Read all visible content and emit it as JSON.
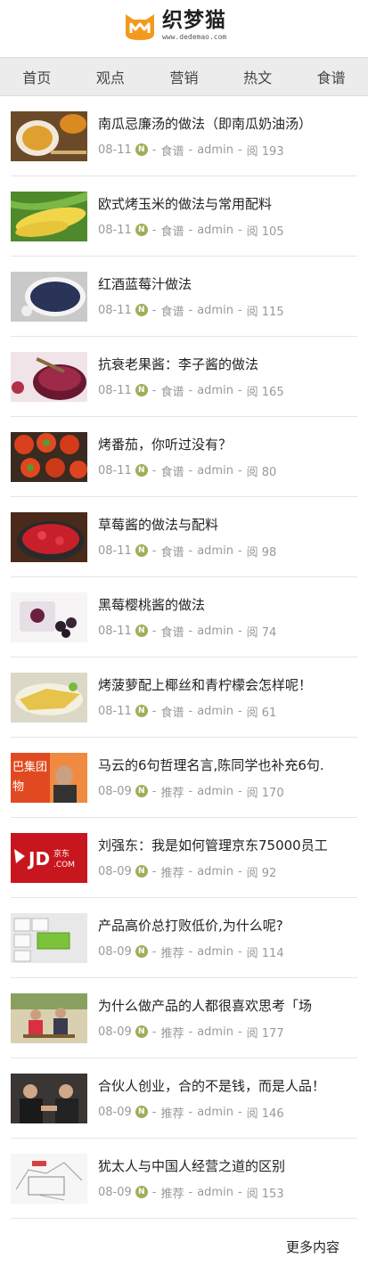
{
  "header": {
    "logo_cn": "织梦猫",
    "logo_url": "www.dedemao.com"
  },
  "nav": [
    "首页",
    "观点",
    "营销",
    "热文",
    "食谱"
  ],
  "articles": [
    {
      "title": "南瓜忌廉汤的做法（即南瓜奶油汤）",
      "date": "08-11",
      "category": "食谱",
      "author": "admin",
      "views": "阅 193",
      "thumb": "pumpkin-soup"
    },
    {
      "title": "欧式烤玉米的做法与常用配料",
      "date": "08-11",
      "category": "食谱",
      "author": "admin",
      "views": "阅 105",
      "thumb": "corn"
    },
    {
      "title": "红酒蓝莓汁做法",
      "date": "08-11",
      "category": "食谱",
      "author": "admin",
      "views": "阅 115",
      "thumb": "blueberry"
    },
    {
      "title": "抗衰老果酱：李子酱的做法",
      "date": "08-11",
      "category": "食谱",
      "author": "admin",
      "views": "阅 165",
      "thumb": "plum-jam"
    },
    {
      "title": "烤番茄，你听过没有？",
      "date": "08-11",
      "category": "食谱",
      "author": "admin",
      "views": "阅 80",
      "thumb": "tomato"
    },
    {
      "title": "草莓酱的做法与配料",
      "date": "08-11",
      "category": "食谱",
      "author": "admin",
      "views": "阅 98",
      "thumb": "strawberry"
    },
    {
      "title": "黑莓樱桃酱的做法",
      "date": "08-11",
      "category": "食谱",
      "author": "admin",
      "views": "阅 74",
      "thumb": "blackberry"
    },
    {
      "title": "烤菠萝配上椰丝和青柠檬会怎样呢！",
      "date": "08-11",
      "category": "食谱",
      "author": "admin",
      "views": "阅 61",
      "thumb": "pineapple"
    },
    {
      "title": "马云的6句哲理名言,陈同学也补充6句.",
      "date": "08-09",
      "category": "推荐",
      "author": "admin",
      "views": "阅 170",
      "thumb": "alibaba"
    },
    {
      "title": "刘强东：我是如何管理京东75000员工",
      "date": "08-09",
      "category": "推荐",
      "author": "admin",
      "views": "阅 92",
      "thumb": "jd"
    },
    {
      "title": "产品高价总打败低价,为什么呢?",
      "date": "08-09",
      "category": "推荐",
      "author": "admin",
      "views": "阅 114",
      "thumb": "keyboard"
    },
    {
      "title": "为什么做产品的人都很喜欢思考「场",
      "date": "08-09",
      "category": "推荐",
      "author": "admin",
      "views": "阅 177",
      "thumb": "people"
    },
    {
      "title": "合伙人创业，合的不是钱，而是人品！",
      "date": "08-09",
      "category": "推荐",
      "author": "admin",
      "views": "阅 146",
      "thumb": "partners"
    },
    {
      "title": "犹太人与中国人经营之道的区别",
      "date": "08-09",
      "category": "推荐",
      "author": "admin",
      "views": "阅 153",
      "thumb": "sketch"
    }
  ],
  "more_label": "更多内容",
  "colors": {
    "nav_bg": "#ececec",
    "n_badge": "#9db058",
    "logo_orange": "#f39a1e"
  }
}
